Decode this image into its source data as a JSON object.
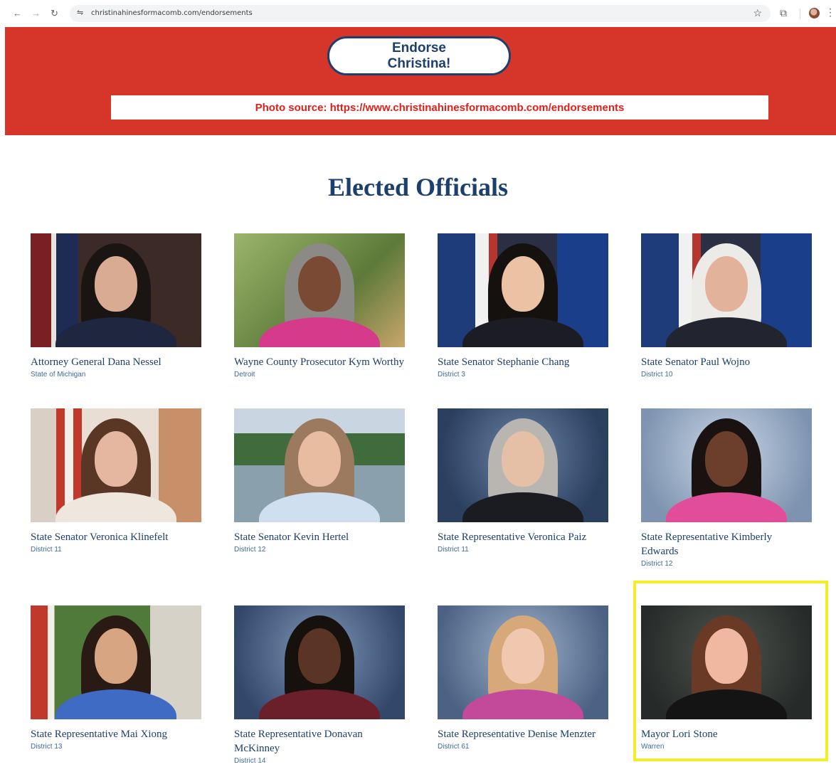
{
  "browser": {
    "url": "christinahinesformacomb.com/endorsements"
  },
  "banner": {
    "button_label": "Endorse\nChristina!",
    "source_text": "Photo source: https://www.christinahinesformacomb.com/endorsements",
    "background_color": "#d6362a"
  },
  "section": {
    "title": "Elected Officials"
  },
  "officials": [
    {
      "name": "Attorney General Dana Nessel",
      "sub": "State of Michigan"
    },
    {
      "name": "Wayne County Prosecutor Kym Worthy",
      "sub": "Detroit"
    },
    {
      "name": "State Senator Stephanie Chang",
      "sub": "District 3"
    },
    {
      "name": "State Senator Paul Wojno",
      "sub": "District 10"
    },
    {
      "name": "State Senator Veronica Klinefelt",
      "sub": "District 11"
    },
    {
      "name": "State Senator Kevin Hertel",
      "sub": "District 12"
    },
    {
      "name": "State Representative Veronica Paiz",
      "sub": "District 11"
    },
    {
      "name": "State Representative Kimberly Edwards",
      "sub": "District 12"
    },
    {
      "name": "State Representative Mai Xiong",
      "sub": "District 13"
    },
    {
      "name": "State Representative Donavan McKinney",
      "sub": "District 14"
    },
    {
      "name": "State Representative Denise Menzter",
      "sub": "District 61"
    },
    {
      "name": "Mayor Lori Stone",
      "sub": "Warren"
    }
  ],
  "colors": {
    "heading": "#1c3f6e",
    "highlight": "#f2ee2a"
  }
}
